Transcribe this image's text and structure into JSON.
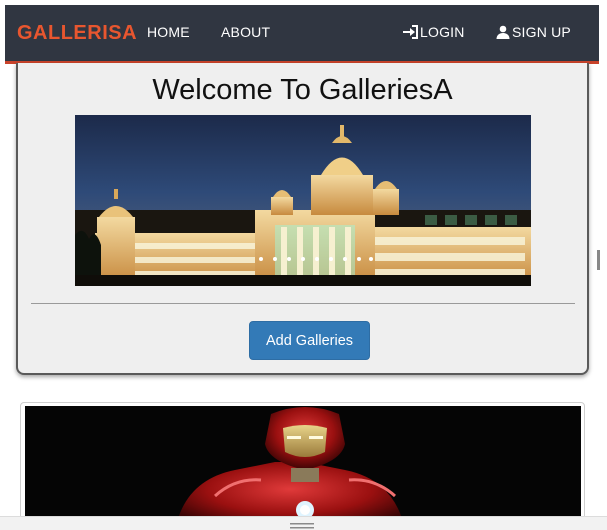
{
  "navbar": {
    "brand": "GALLERISA",
    "links": {
      "home": "HOME",
      "about": "ABOUT",
      "login": "LOGIN",
      "signup": "SIGN UP"
    },
    "colors": {
      "background": "#303641",
      "brand": "#e8562f",
      "accent_border": "#c9432b"
    },
    "icons": {
      "login": "login-icon",
      "signup": "user-icon"
    }
  },
  "welcome": {
    "title": "Welcome To GalleriesA",
    "add_button": "Add Galleries",
    "button_color": "#337ab7"
  }
}
